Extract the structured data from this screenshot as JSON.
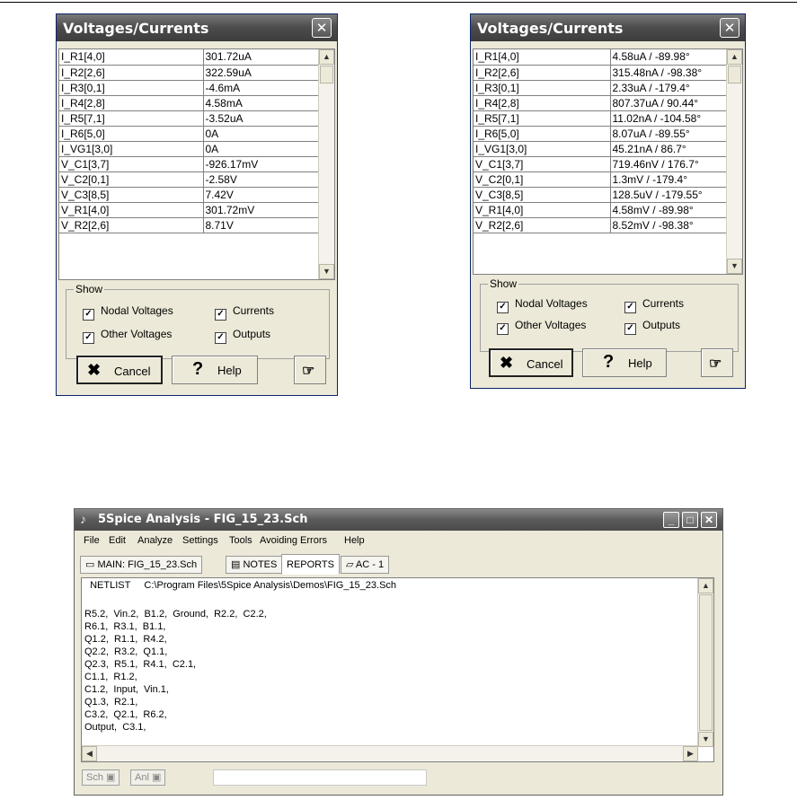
{
  "dialog_left": {
    "title": "Voltages/Currents",
    "rows": [
      [
        "I_R1[4,0]",
        "301.72uA"
      ],
      [
        "I_R2[2,6]",
        "322.59uA"
      ],
      [
        "I_R3[0,1]",
        "-4.6mA"
      ],
      [
        "I_R4[2,8]",
        "4.58mA"
      ],
      [
        "I_R5[7,1]",
        "-3.52uA"
      ],
      [
        "I_R6[5,0]",
        "0A"
      ],
      [
        "I_VG1[3,0]",
        "0A"
      ],
      [
        "V_C1[3,7]",
        "-926.17mV"
      ],
      [
        "V_C2[0,1]",
        "-2.58V"
      ],
      [
        "V_C3[8,5]",
        "7.42V"
      ],
      [
        "V_R1[4,0]",
        "301.72mV"
      ],
      [
        "V_R2[2,6]",
        "8.71V"
      ]
    ],
    "show_label": "Show",
    "checks": [
      "Nodal Voltages",
      "Currents",
      "Other Voltages",
      "Outputs"
    ],
    "cancel_label": "Cancel",
    "help_label": "Help"
  },
  "dialog_right": {
    "title": "Voltages/Currents",
    "rows": [
      [
        "I_R1[4,0]",
        "4.58uA / -89.98°"
      ],
      [
        "I_R2[2,6]",
        "315.48nA / -98.38°"
      ],
      [
        "I_R3[0,1]",
        "2.33uA / -179.4°"
      ],
      [
        "I_R4[2,8]",
        "807.37uA / 90.44°"
      ],
      [
        "I_R5[7,1]",
        "11.02nA / -104.58°"
      ],
      [
        "I_R6[5,0]",
        "8.07uA / -89.55°"
      ],
      [
        "I_VG1[3,0]",
        "45.21nA / 86.7°"
      ],
      [
        "V_C1[3,7]",
        "719.46nV / 176.7°"
      ],
      [
        "V_C2[0,1]",
        "1.3mV / -179.4°"
      ],
      [
        "V_C3[8,5]",
        "128.5uV / -179.55°"
      ],
      [
        "V_R1[4,0]",
        "4.58mV / -89.98°"
      ],
      [
        "V_R2[2,6]",
        "8.52mV / -98.38°"
      ]
    ],
    "show_label": "Show",
    "checks": [
      "Nodal Voltages",
      "Currents",
      "Other Voltages",
      "Outputs"
    ],
    "cancel_label": "Cancel",
    "help_label": "Help"
  },
  "app": {
    "title": "5Spice Analysis - FIG_15_23.Sch",
    "menu": [
      "File",
      "Edit",
      "Analyze",
      "Settings",
      "Tools",
      "Avoiding Errors",
      "Help"
    ],
    "tabs": [
      "MAIN: FIG_15_23.Sch",
      "NOTES",
      "REPORTS",
      "AC - 1"
    ],
    "netlist_header": "  NETLIST     C:\\Program Files\\5Spice Analysis\\Demos\\FIG_15_23.Sch",
    "netlist_lines": [
      "R5.2,  Vin.2,  B1.2,  Ground,  R2.2,  C2.2,",
      "R6.1,  R3.1,  B1.1,",
      "Q1.2,  R1.1,  R4.2,",
      "Q2.2,  R3.2,  Q1.1,",
      "Q2.3,  R5.1,  R4.1,  C2.1,",
      "C1.1,  R1.2,",
      "C1.2,  Input,  Vin.1,",
      "Q1.3,  R2.1,",
      "C3.2,  Q2.1,  R6.2,",
      "Output,  C3.1,"
    ],
    "status_sch": "Sch",
    "status_anl": "Anl"
  },
  "colors": {
    "window_face": "#ece9d8",
    "titlebar": "#4e4e4e"
  }
}
